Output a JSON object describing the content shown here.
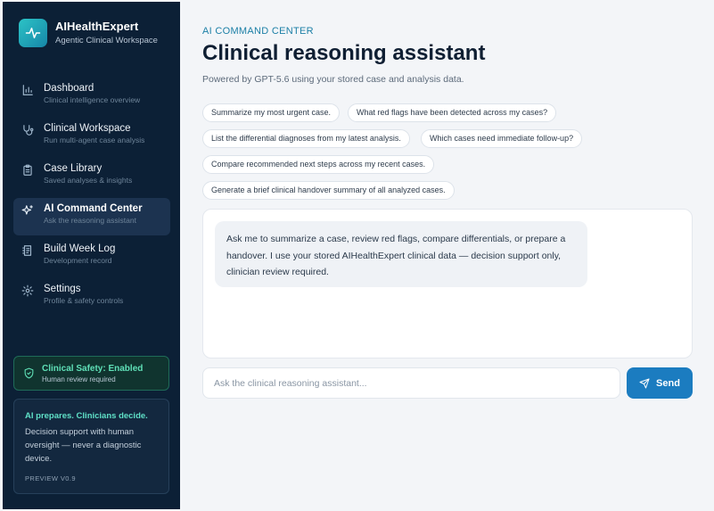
{
  "brand": {
    "title": "AIHealthExpert",
    "subtitle": "Agentic Clinical Workspace",
    "icon": "pulse-icon"
  },
  "nav": [
    {
      "label": "Dashboard",
      "sub": "Clinical intelligence overview",
      "icon": "bar-chart-icon",
      "active": false
    },
    {
      "label": "Clinical Workspace",
      "sub": "Run multi-agent case analysis",
      "icon": "stethoscope-icon",
      "active": false
    },
    {
      "label": "Case Library",
      "sub": "Saved analyses & insights",
      "icon": "clipboard-icon",
      "active": false
    },
    {
      "label": "AI Command Center",
      "sub": "Ask the reasoning assistant",
      "icon": "sparkles-icon",
      "active": true
    },
    {
      "label": "Build Week Log",
      "sub": "Development record",
      "icon": "log-icon",
      "active": false
    },
    {
      "label": "Settings",
      "sub": "Profile & safety controls",
      "icon": "gear-icon",
      "active": false
    }
  ],
  "safety": {
    "title": "Clinical Safety: Enabled",
    "sub": "Human review required",
    "icon": "shield-check-icon"
  },
  "note": {
    "title": "AI prepares. Clinicians decide.",
    "body": "Decision support with human oversight — never a diagnostic device.",
    "version": "PREVIEW V0.9"
  },
  "header": {
    "eyebrow": "AI COMMAND CENTER",
    "title": "Clinical reasoning assistant",
    "subtitle": "Powered by GPT-5.6 using your stored case and analysis data."
  },
  "suggestions": [
    "Summarize my most urgent case.",
    "What red flags have been detected across my cases?",
    "List the differential diagnoses from my latest analysis.",
    "Which cases need immediate follow-up?",
    "Compare recommended next steps across my recent cases.",
    "Generate a brief clinical handover summary of all analyzed cases."
  ],
  "chat": {
    "assistant_message": "Ask me to summarize a case, review red flags, compare differentials, or prepare a handover. I use your stored AIHealthExpert clinical data — decision support only, clinician review required."
  },
  "composer": {
    "value": "",
    "placeholder": "Ask the clinical reasoning assistant...",
    "send_label": "Send",
    "send_icon": "paper-plane-icon"
  },
  "colors": {
    "sidebar_bg": "#0c2036",
    "accent": "#1b7cc0",
    "brand_teal": "#2cc3c6",
    "safety_green": "#5fe0b7",
    "eyebrow": "#1b7fa6"
  }
}
